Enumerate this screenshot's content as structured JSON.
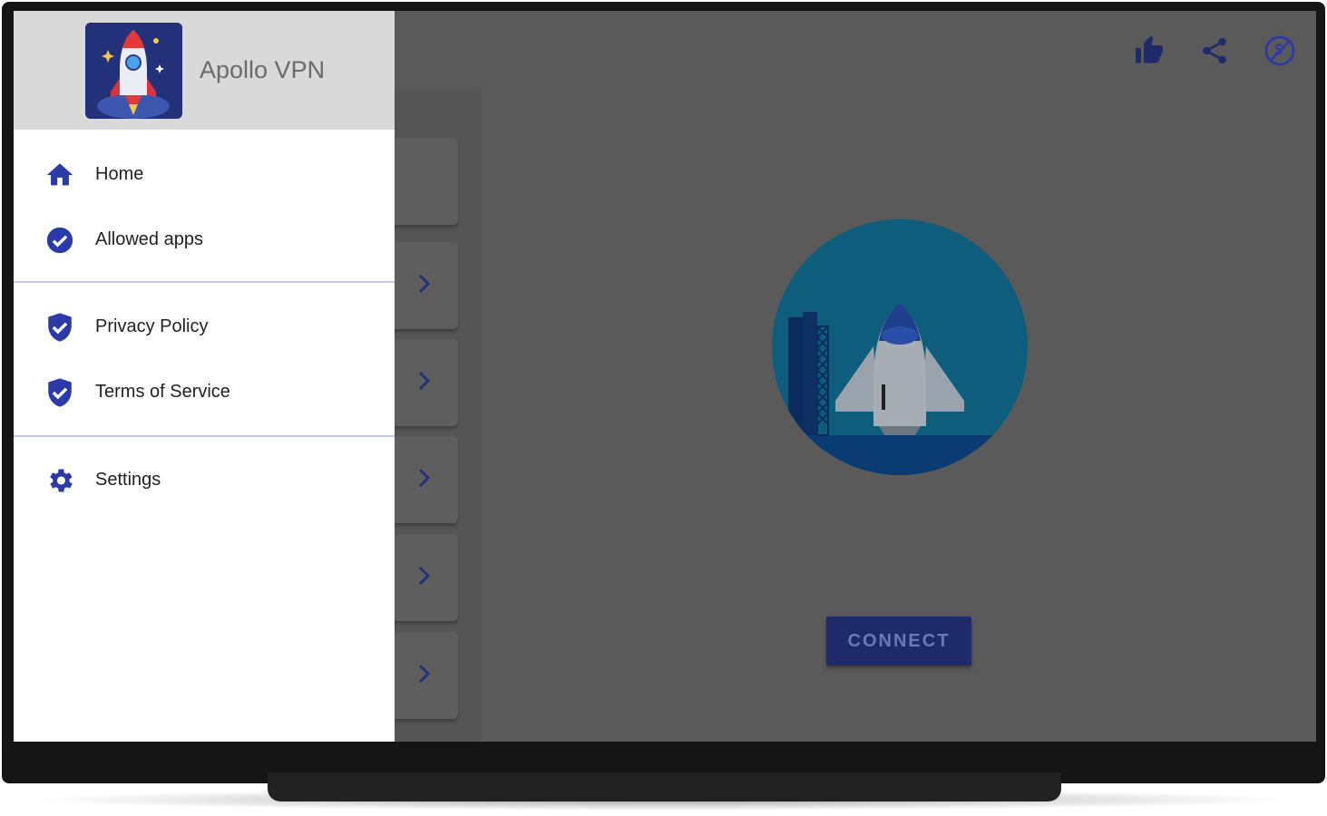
{
  "drawer": {
    "app_name": "Apollo VPN",
    "logo_icon": "rocket-logo-icon",
    "items": [
      {
        "label": "Home",
        "icon": "home-icon"
      },
      {
        "label": "Allowed apps",
        "icon": "check-circle-icon"
      },
      {
        "label": "Privacy Policy",
        "icon": "shield-check-icon"
      },
      {
        "label": "Terms of Service",
        "icon": "shield-check-icon"
      },
      {
        "label": "Settings",
        "icon": "gear-icon"
      }
    ]
  },
  "toolbar": {
    "icons": [
      "thumbs-up-icon",
      "share-icon",
      "no-ads-icon"
    ]
  },
  "main": {
    "connect_label": "CONNECT",
    "server_cards": 6
  },
  "colors": {
    "accent": "#2b3aa6",
    "overlay": "#5a5a5a",
    "drawer_header": "#d9d9d9",
    "divider": "#c5c8ec",
    "connect_button": "#1f2a6b"
  }
}
